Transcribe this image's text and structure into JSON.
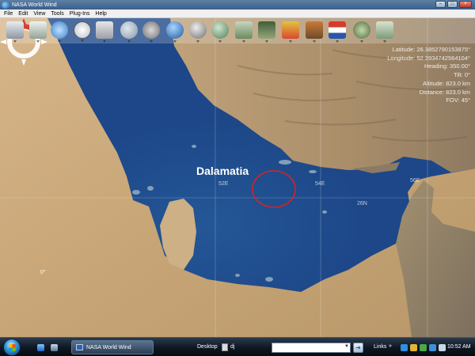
{
  "window": {
    "title": "NASA World Wind"
  },
  "menu": [
    "File",
    "Edit",
    "View",
    "Tools",
    "Plug-Ins",
    "Help"
  ],
  "toolbar_icons": [
    "layers-icon",
    "placemark-icon",
    "globe-grid-icon",
    "clock-icon",
    "scale-bar-icon",
    "search-icon",
    "satellite-icon",
    "blue-marble-icon",
    "moon-icon",
    "compass-globe-icon",
    "usgs-topo-icon",
    "landsat-icon",
    "modis-icon",
    "gdem-icon",
    "flag-icon",
    "plugin-icon",
    "usa-map-icon"
  ],
  "readout": [
    "Latitude: 26.3852790153875°",
    "Longitude: 52.3934742564104°",
    "Heading: 350.00°",
    "Tilt: 0°",
    "Altitude: 823.0 km",
    "Distance: 823.0 km",
    "FOV: 45°"
  ],
  "map": {
    "place_label": "Dalamatia",
    "grid_labels": [
      "52E",
      "54E",
      "56E",
      "26N"
    ]
  },
  "compass": {
    "heading_text": "0°"
  },
  "taskbar": {
    "task_label": "NASA World Wind",
    "desktop_label": "Desktop",
    "dj_label": "dj",
    "links_label": "Links",
    "links_chevron": "»",
    "address_value": "",
    "clock": "10:52 AM"
  },
  "colors": {
    "water": "#1d4788",
    "land": "#c9a878",
    "marker": "#e02020"
  }
}
